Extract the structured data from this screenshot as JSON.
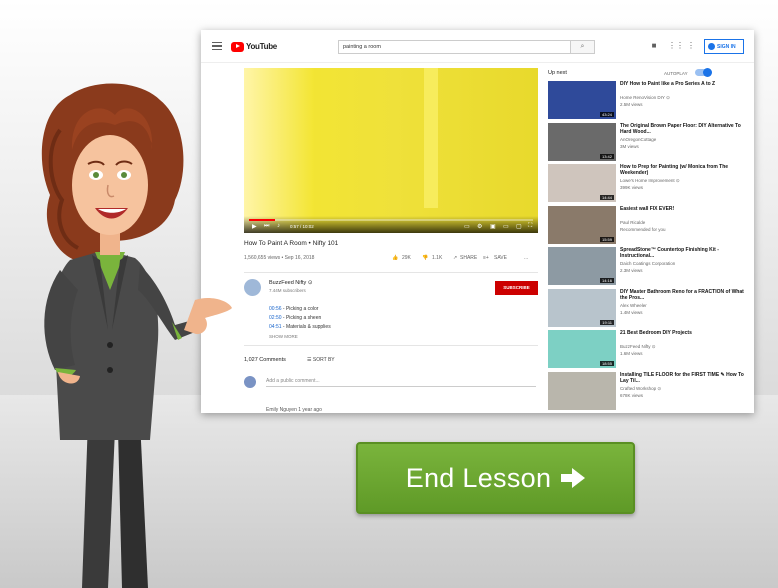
{
  "lesson": {
    "end_button_label": "End Lesson"
  },
  "youtube": {
    "logo_text": "YouTube",
    "search_query": "painting a room",
    "sign_in_label": "SIGN IN",
    "player": {
      "time": "0:57 / 10:02",
      "progress": 0.09
    },
    "video": {
      "title": "How To Paint A Room • Nifty 101",
      "meta": "1,560,655 views • Sep 16, 2018",
      "likes": "29K",
      "dislikes": "1.1K",
      "share_label": "SHARE",
      "save_label": "SAVE",
      "more_label": "...",
      "channel_name": "BuzzFeed Nifty ⊙",
      "channel_subs": "7.44M subscribers",
      "subscribe_label": "SUBSCRIBE",
      "chapters": [
        {
          "time": "00:56",
          "text": " - Picking a color"
        },
        {
          "time": "02:50",
          "text": " - Picking a sheen"
        },
        {
          "time": "04:51",
          "text": " - Materials & supplies"
        }
      ],
      "show_more": "SHOW MORE",
      "comments_count": "1,027 Comments",
      "sort_by": "SORT BY",
      "add_comment_placeholder": "Add a public comment...",
      "next_commenter": "Emily Nguyen  1 year ago"
    },
    "up_next_label": "Up next",
    "autoplay_label": "AUTOPLAY",
    "recommendations": [
      {
        "title": "DIY How to Paint like a Pro Series A to Z",
        "channel": "Home RenoVision DIY ⊙",
        "views": "2.5M views",
        "duration": "43:24",
        "thumb": "#2f4a9a"
      },
      {
        "title": "The Original Brown Paper Floor: DIY Alternative To Hard Wood...",
        "channel": "AnOregonCottage",
        "views": "3M views",
        "duration": "13:42",
        "thumb": "#6a6a6a"
      },
      {
        "title": "How to Prep for Painting (w/ Monica from The Weekender)",
        "channel": "Lowe's Home Improvement ⊙",
        "views": "399K views",
        "duration": "14:44",
        "thumb": "#cfc5bd"
      },
      {
        "title": "Easiest wall FIX EVER!",
        "channel": "Paul Ricalde",
        "views": "Recommended for you",
        "duration": "15:59",
        "thumb": "#8a7a6a"
      },
      {
        "title": "SpreadStone™ Countertop Finishing Kit - Instructional...",
        "channel": "Daich Coatings Corporation",
        "views": "2.3M views",
        "duration": "14:16",
        "thumb": "#8d9aa3"
      },
      {
        "title": "DIY Master Bathroom Reno for a FRACTION of What the Pros...",
        "channel": "Alex Wheeler",
        "views": "1.4M views",
        "duration": "19:11",
        "thumb": "#b8c4cc"
      },
      {
        "title": "21 Best Bedroom DIY Projects",
        "channel": "BuzzFeed Nifty ⊙",
        "views": "1.6M views",
        "duration": "18:55",
        "thumb": "#7dd0c4"
      },
      {
        "title": "Installing TILE FLOOR for the FIRST TIME ✎ How To Lay Til...",
        "channel": "Crafted Workshop ⊙",
        "views": "678K views",
        "duration": "",
        "thumb": "#b9b6ac"
      }
    ]
  },
  "colors": {
    "end_button": "#7ab43c",
    "youtube_red": "#ff0000",
    "link_blue": "#1a66cc",
    "paint_yellow": "#f0e22a"
  }
}
